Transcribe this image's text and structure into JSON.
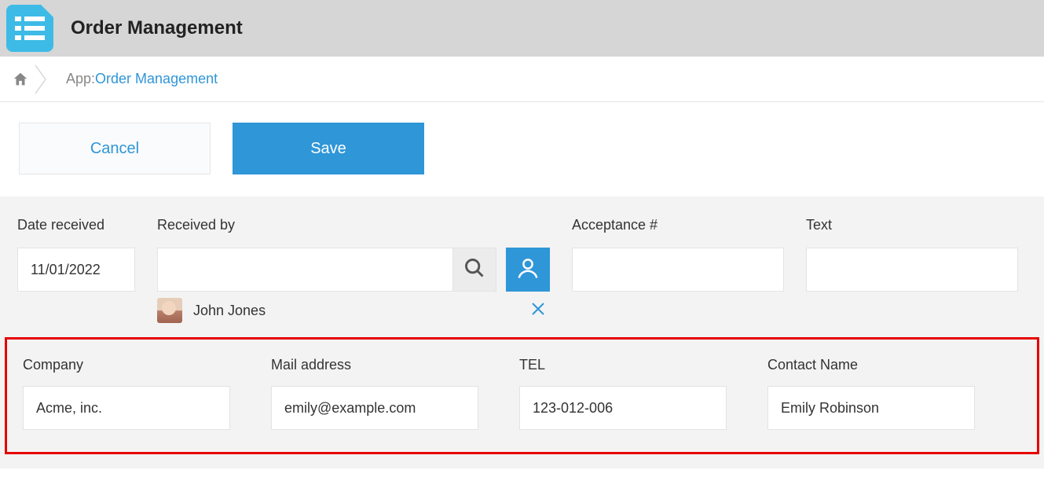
{
  "header": {
    "title": "Order Management"
  },
  "breadcrumb": {
    "prefix": "App: ",
    "link": "Order Management"
  },
  "actions": {
    "cancel": "Cancel",
    "save": "Save"
  },
  "form": {
    "date_received": {
      "label": "Date received",
      "value": "11/01/2022"
    },
    "received_by": {
      "label": "Received by",
      "value": "",
      "selected_user": "John Jones"
    },
    "acceptance": {
      "label": "Acceptance #",
      "value": ""
    },
    "text": {
      "label": "Text",
      "value": ""
    },
    "company": {
      "label": "Company",
      "value": "Acme, inc."
    },
    "mail": {
      "label": "Mail address",
      "value": "emily@example.com"
    },
    "tel": {
      "label": "TEL",
      "value": "123-012-006"
    },
    "contact": {
      "label": "Contact Name",
      "value": "Emily Robinson"
    }
  }
}
